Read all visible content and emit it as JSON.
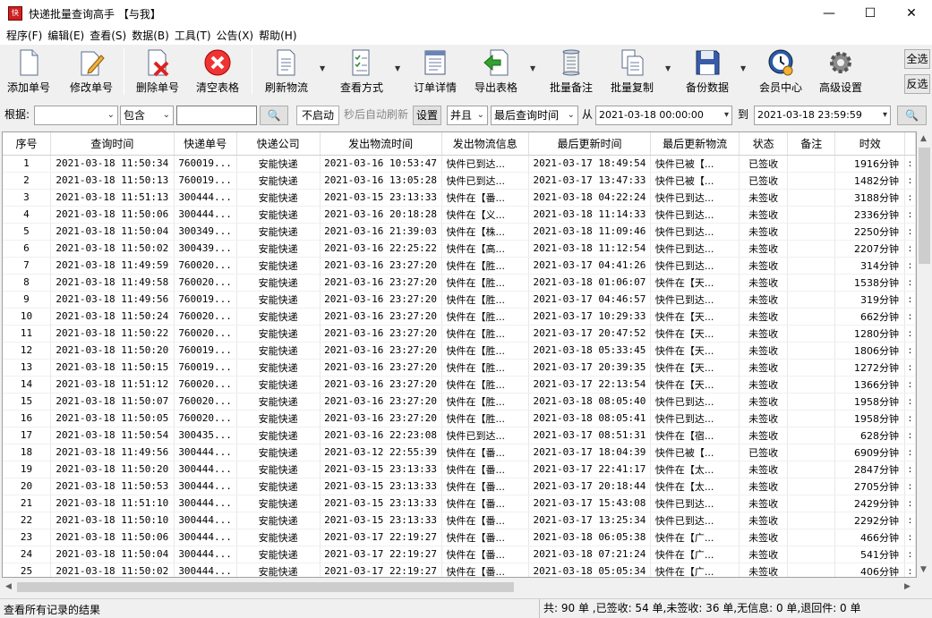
{
  "window": {
    "title": "快递批量查询高手 【与我】",
    "app_icon_text": "快",
    "minimize": "—",
    "maximize": "☐",
    "close": "✕"
  },
  "menu": [
    "程序(F)",
    "编辑(E)",
    "查看(S)",
    "数据(B)",
    "工具(T)",
    "公告(X)",
    "帮助(H)"
  ],
  "toolbar": {
    "buttons": [
      {
        "label": "添加单号",
        "icon": "document-icon"
      },
      {
        "label": "修改单号",
        "icon": "pencil-document-icon"
      },
      {
        "label": "删除单号",
        "icon": "delete-document-icon"
      },
      {
        "label": "清空表格",
        "icon": "clear-red-x-icon"
      },
      {
        "label": "刷新物流",
        "icon": "refresh-document-icon"
      },
      {
        "label": "查看方式",
        "icon": "checklist-icon"
      },
      {
        "label": "订单详情",
        "icon": "order-detail-icon"
      },
      {
        "label": "导出表格",
        "icon": "export-green-arrow-icon"
      },
      {
        "label": "批量备注",
        "icon": "notes-scroll-icon"
      },
      {
        "label": "批量复制",
        "icon": "copy-documents-icon"
      },
      {
        "label": "备份数据",
        "icon": "floppy-disk-icon"
      },
      {
        "label": "会员中心",
        "icon": "member-clock-icon"
      },
      {
        "label": "高级设置",
        "icon": "gear-icon"
      }
    ],
    "select_all": "全选",
    "invert": "反选"
  },
  "filter": {
    "basis_label": "根据:",
    "basis_value": "",
    "match_value": "包含",
    "keyword": "",
    "search_icon": "🔍",
    "not_started": "不启动",
    "auto_refresh_label": "秒后自动刷新",
    "settings": "设置",
    "logic_value": "并且",
    "time_field": "最后查询时间",
    "from_label": "从",
    "from_value": "2021-03-18 00:00:00",
    "to_label": "到",
    "to_value": "2021-03-18 23:59:59"
  },
  "table": {
    "columns": [
      "序号",
      "查询时间",
      "快递单号",
      "快递公司",
      "发出物流时间",
      "发出物流信息",
      "最后更新时间",
      "最后更新物流",
      "状态",
      "备注",
      "时效"
    ],
    "rows": [
      [
        "1",
        "2021-03-18 11:50:34",
        "760019...",
        "安能快递",
        "2021-03-16 10:53:47",
        "快件已到达...",
        "2021-03-17 18:49:54",
        "快件已被【...",
        "已签收",
        "",
        "1916分钟"
      ],
      [
        "2",
        "2021-03-18 11:50:13",
        "760019...",
        "安能快递",
        "2021-03-16 13:05:28",
        "快件已到达...",
        "2021-03-17 13:47:33",
        "快件已被【...",
        "已签收",
        "",
        "1482分钟"
      ],
      [
        "3",
        "2021-03-18 11:51:13",
        "300444...",
        "安能快递",
        "2021-03-15 23:13:33",
        "快件在【番...",
        "2021-03-18 04:22:24",
        "快件已到达...",
        "未签收",
        "",
        "3188分钟"
      ],
      [
        "4",
        "2021-03-18 11:50:06",
        "300444...",
        "安能快递",
        "2021-03-16 20:18:28",
        "快件在【义...",
        "2021-03-18 11:14:33",
        "快件已到达...",
        "未签收",
        "",
        "2336分钟"
      ],
      [
        "5",
        "2021-03-18 11:50:04",
        "300349...",
        "安能快递",
        "2021-03-16 21:39:03",
        "快件在【株...",
        "2021-03-18 11:09:46",
        "快件已到达...",
        "未签收",
        "",
        "2250分钟"
      ],
      [
        "6",
        "2021-03-18 11:50:02",
        "300439...",
        "安能快递",
        "2021-03-16 22:25:22",
        "快件在【高...",
        "2021-03-18 11:12:54",
        "快件已到达...",
        "未签收",
        "",
        "2207分钟"
      ],
      [
        "7",
        "2021-03-18 11:49:59",
        "760020...",
        "安能快递",
        "2021-03-16 23:27:20",
        "快件在【胜...",
        "2021-03-17 04:41:26",
        "快件已到达...",
        "未签收",
        "",
        "314分钟"
      ],
      [
        "8",
        "2021-03-18 11:49:58",
        "760020...",
        "安能快递",
        "2021-03-16 23:27:20",
        "快件在【胜...",
        "2021-03-18 01:06:07",
        "快件在【天...",
        "未签收",
        "",
        "1538分钟"
      ],
      [
        "9",
        "2021-03-18 11:49:56",
        "760019...",
        "安能快递",
        "2021-03-16 23:27:20",
        "快件在【胜...",
        "2021-03-17 04:46:57",
        "快件已到达...",
        "未签收",
        "",
        "319分钟"
      ],
      [
        "10",
        "2021-03-18 11:50:24",
        "760020...",
        "安能快递",
        "2021-03-16 23:27:20",
        "快件在【胜...",
        "2021-03-17 10:29:33",
        "快件在【天...",
        "未签收",
        "",
        "662分钟"
      ],
      [
        "11",
        "2021-03-18 11:50:22",
        "760020...",
        "安能快递",
        "2021-03-16 23:27:20",
        "快件在【胜...",
        "2021-03-17 20:47:52",
        "快件在【天...",
        "未签收",
        "",
        "1280分钟"
      ],
      [
        "12",
        "2021-03-18 11:50:20",
        "760019...",
        "安能快递",
        "2021-03-16 23:27:20",
        "快件在【胜...",
        "2021-03-18 05:33:45",
        "快件在【天...",
        "未签收",
        "",
        "1806分钟"
      ],
      [
        "13",
        "2021-03-18 11:50:15",
        "760019...",
        "安能快递",
        "2021-03-16 23:27:20",
        "快件在【胜...",
        "2021-03-17 20:39:35",
        "快件在【天...",
        "未签收",
        "",
        "1272分钟"
      ],
      [
        "14",
        "2021-03-18 11:51:12",
        "760020...",
        "安能快递",
        "2021-03-16 23:27:20",
        "快件在【胜...",
        "2021-03-17 22:13:54",
        "快件在【天...",
        "未签收",
        "",
        "1366分钟"
      ],
      [
        "15",
        "2021-03-18 11:50:07",
        "760020...",
        "安能快递",
        "2021-03-16 23:27:20",
        "快件在【胜...",
        "2021-03-18 08:05:40",
        "快件已到达...",
        "未签收",
        "",
        "1958分钟"
      ],
      [
        "16",
        "2021-03-18 11:50:05",
        "760020...",
        "安能快递",
        "2021-03-16 23:27:20",
        "快件在【胜...",
        "2021-03-18 08:05:41",
        "快件已到达...",
        "未签收",
        "",
        "1958分钟"
      ],
      [
        "17",
        "2021-03-18 11:50:54",
        "300435...",
        "安能快递",
        "2021-03-16 22:23:08",
        "快件已到达...",
        "2021-03-17 08:51:31",
        "快件在【宿...",
        "未签收",
        "",
        "628分钟"
      ],
      [
        "18",
        "2021-03-18 11:49:56",
        "300444...",
        "安能快递",
        "2021-03-12 22:55:39",
        "快件在【番...",
        "2021-03-17 18:04:39",
        "快件已被【...",
        "已签收",
        "",
        "6909分钟"
      ],
      [
        "19",
        "2021-03-18 11:50:20",
        "300444...",
        "安能快递",
        "2021-03-15 23:13:33",
        "快件在【番...",
        "2021-03-17 22:41:17",
        "快件在【太...",
        "未签收",
        "",
        "2847分钟"
      ],
      [
        "20",
        "2021-03-18 11:50:53",
        "300444...",
        "安能快递",
        "2021-03-15 23:13:33",
        "快件在【番...",
        "2021-03-17 20:18:44",
        "快件在【太...",
        "未签收",
        "",
        "2705分钟"
      ],
      [
        "21",
        "2021-03-18 11:51:10",
        "300444...",
        "安能快递",
        "2021-03-15 23:13:33",
        "快件在【番...",
        "2021-03-17 15:43:08",
        "快件已到达...",
        "未签收",
        "",
        "2429分钟"
      ],
      [
        "22",
        "2021-03-18 11:50:10",
        "300444...",
        "安能快递",
        "2021-03-15 23:13:33",
        "快件在【番...",
        "2021-03-17 13:25:34",
        "快件已到达...",
        "未签收",
        "",
        "2292分钟"
      ],
      [
        "23",
        "2021-03-18 11:50:06",
        "300444...",
        "安能快递",
        "2021-03-17 22:19:27",
        "快件在【番...",
        "2021-03-18 06:05:38",
        "快件在【广...",
        "未签收",
        "",
        "466分钟"
      ],
      [
        "24",
        "2021-03-18 11:50:04",
        "300444...",
        "安能快递",
        "2021-03-17 22:19:27",
        "快件在【番...",
        "2021-03-18 07:21:24",
        "快件在【广...",
        "未签收",
        "",
        "541分钟"
      ],
      [
        "25",
        "2021-03-18 11:50:02",
        "300444...",
        "安能快递",
        "2021-03-17 22:19:27",
        "快件在【番...",
        "2021-03-18 05:05:34",
        "快件在【广...",
        "未签收",
        "",
        "406分钟"
      ]
    ]
  },
  "status": {
    "left": "查看所有记录的结果",
    "right": "共: 90 单 ,已签收: 54 单,未签收: 36 单,无信息: 0 单,退回件: 0 单"
  }
}
